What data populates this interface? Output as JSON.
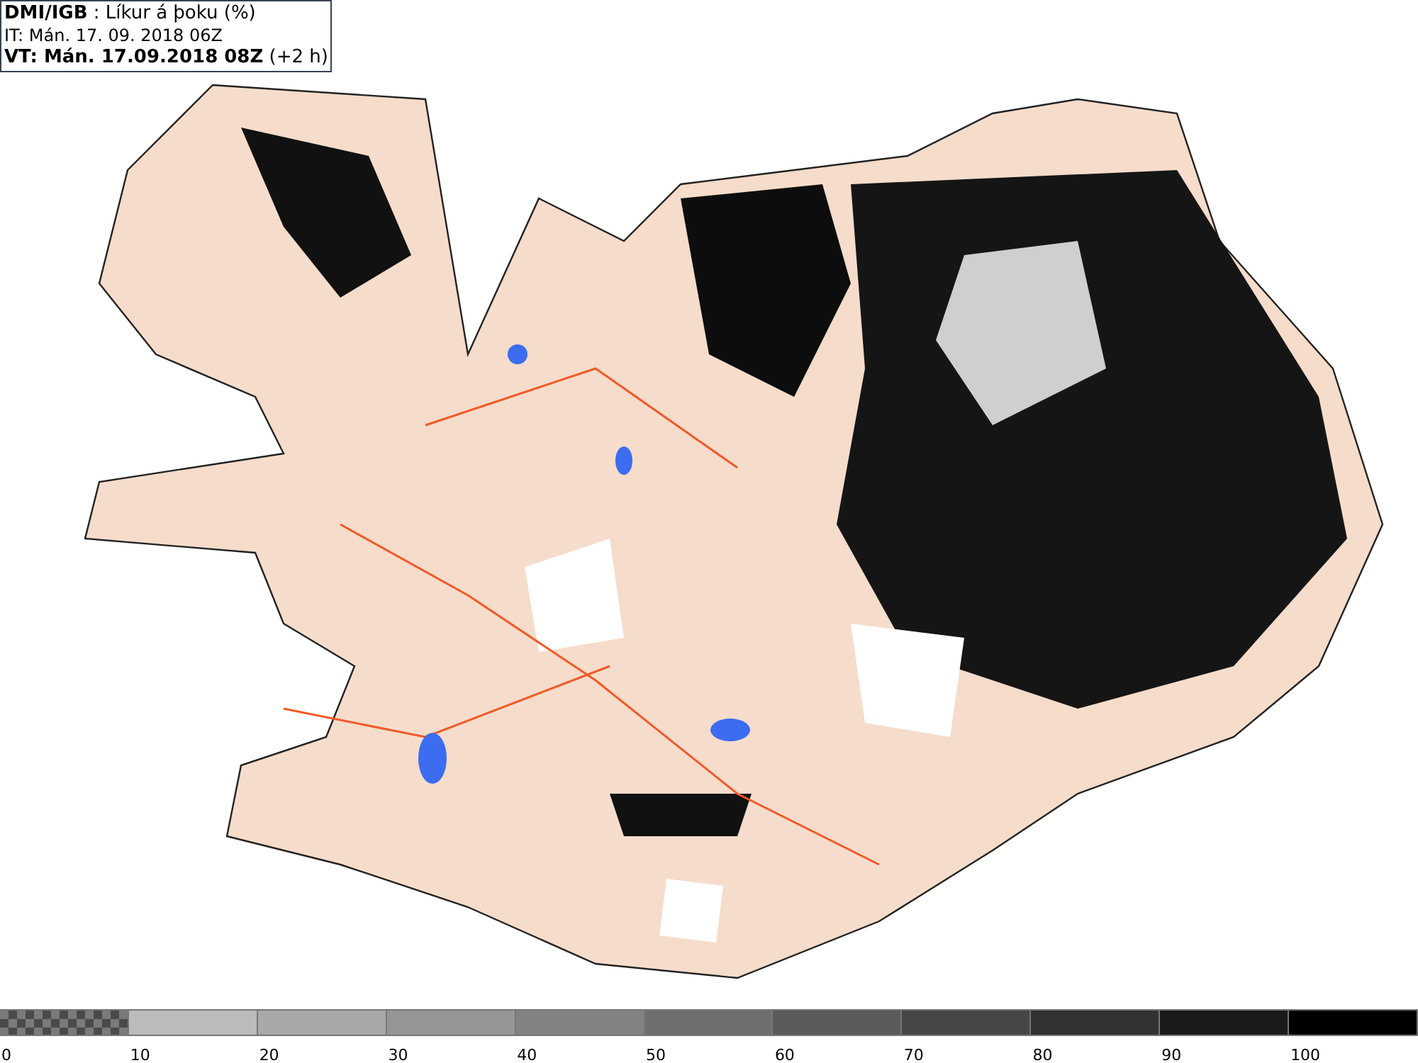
{
  "header": {
    "lines": [
      "**DMI/IGB** : Líkur á þoku (%)",
      "IT: Mán. 17. 09. 2018 06Z",
      "**VT: Mán. 17.09.2018 08Z** (+2 h)"
    ]
  },
  "legend": {
    "segments": [
      {
        "kind": "checker",
        "color": "#7a7a7a"
      },
      {
        "kind": "solid",
        "color": "#bbbbbb"
      },
      {
        "kind": "solid",
        "color": "#a8a8a8"
      },
      {
        "kind": "solid",
        "color": "#969696"
      },
      {
        "kind": "solid",
        "color": "#828282"
      },
      {
        "kind": "solid",
        "color": "#6e6e6e"
      },
      {
        "kind": "solid",
        "color": "#5a5a5a"
      },
      {
        "kind": "solid",
        "color": "#464646"
      },
      {
        "kind": "solid",
        "color": "#323232"
      },
      {
        "kind": "solid",
        "color": "#1a1a1a"
      },
      {
        "kind": "solid",
        "color": "#000000"
      }
    ],
    "labels": [
      "0",
      "10",
      "20",
      "30",
      "40",
      "50",
      "60",
      "70",
      "80",
      "90",
      "100"
    ]
  }
}
